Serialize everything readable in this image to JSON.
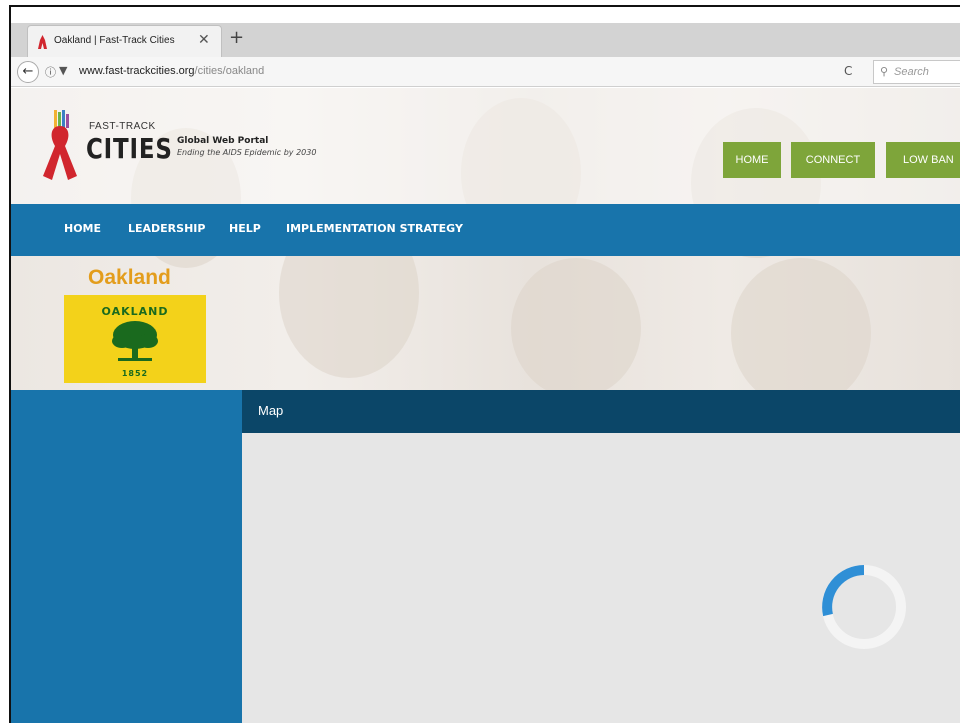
{
  "browser": {
    "tab_title": "Oakland | Fast-Track Cities",
    "tab_close": "✕",
    "new_tab": "+",
    "url_domain": "www.fast-trackcities.org",
    "url_path": "/cities/oakland",
    "search_placeholder": "Search"
  },
  "site": {
    "logo_fast_track": "FAST-TRACK",
    "logo_cities": "CITIES",
    "portal_title": "Global Web Portal",
    "portal_subtitle": "Ending the AIDS Epidemic by 2030",
    "top_buttons": [
      "HOME",
      "CONNECT",
      "LOW BAN"
    ],
    "nav": [
      "HOME",
      "LEADERSHIP",
      "HELP",
      "IMPLEMENTATION STRATEGY"
    ],
    "city_name": "Oakland",
    "flag_text": "OAKLAND",
    "flag_year": "1852",
    "map_title": "Map"
  },
  "colors": {
    "nav_blue": "#1874ab",
    "map_header": "#0b4668",
    "button_green": "#7ea53a",
    "city_orange": "#e39d1c",
    "spinner": "#2f8fd6"
  },
  "status": {
    "map_loading_spinner": "loading-spinner-icon"
  }
}
